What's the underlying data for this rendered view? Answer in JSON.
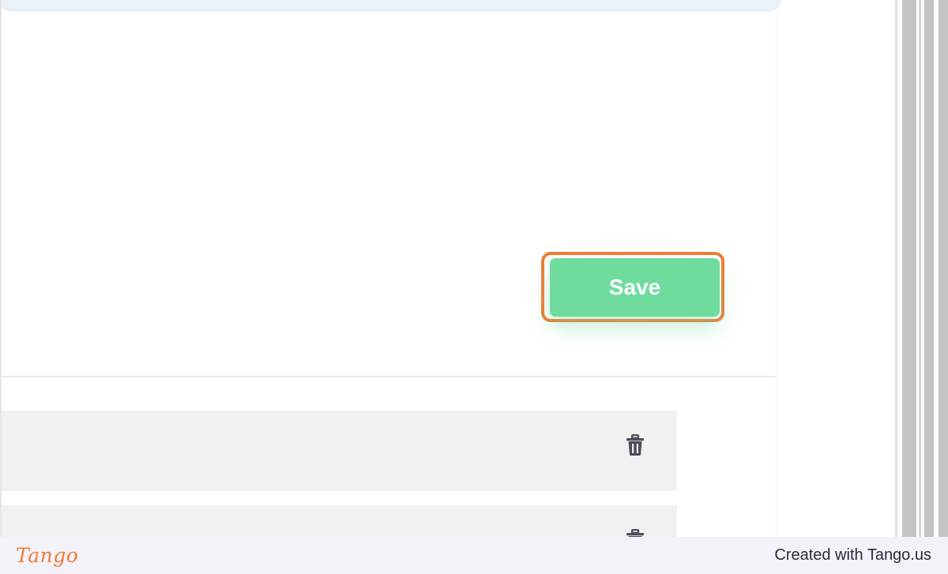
{
  "form": {
    "save_label": "Save"
  },
  "list": {
    "rows": [
      {
        "action_icon": "trash-icon"
      },
      {
        "action_icon": "trash-icon"
      }
    ]
  },
  "footer": {
    "logo_text": "Tango",
    "credit": "Created with Tango.us"
  },
  "colors": {
    "accent_green": "#6fdc9d",
    "highlight_orange": "#f07b34",
    "row_background": "#f1f1f1",
    "footer_background": "#f3f2f8"
  }
}
